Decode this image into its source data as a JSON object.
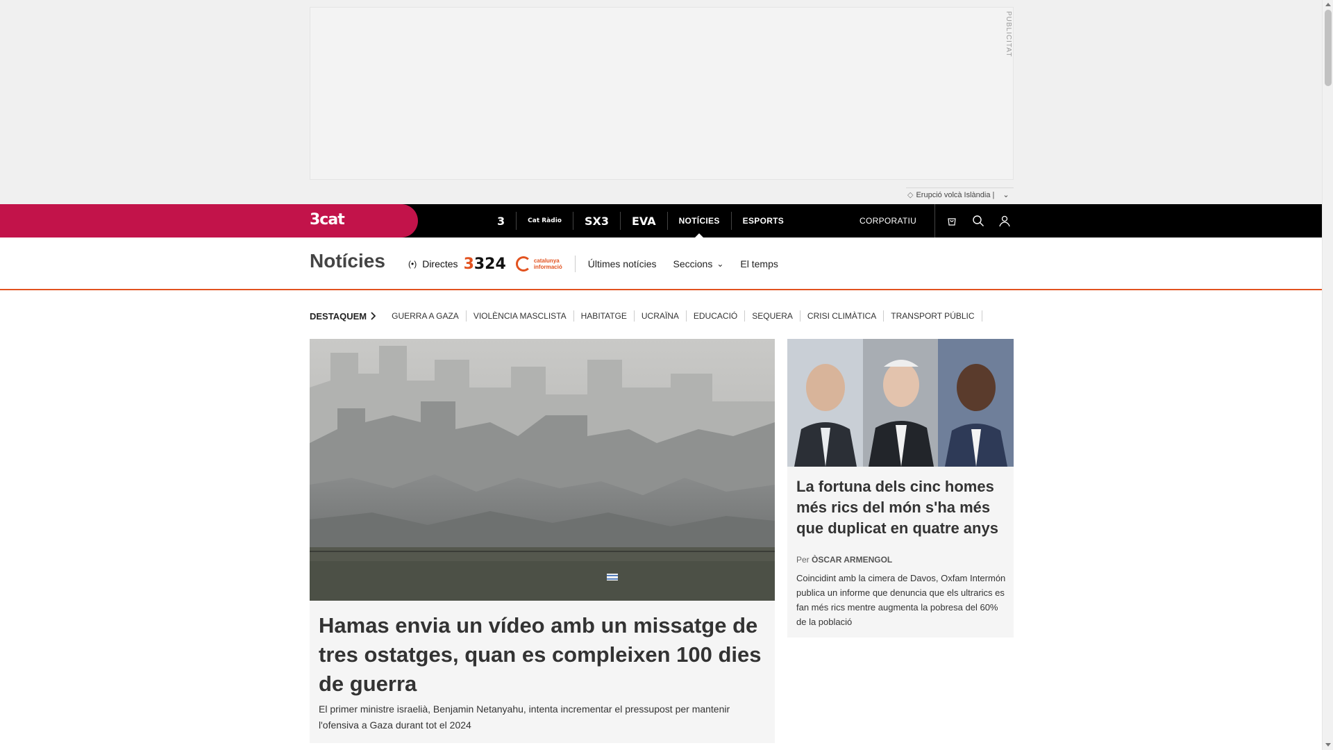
{
  "ad": {
    "label": "PUBLICITAT"
  },
  "trending": {
    "text": "Erupció volcà Islàndia |"
  },
  "topbar": {
    "logo": "3cat",
    "channels": [
      {
        "label": "3"
      },
      {
        "label": "Cat Ràdio"
      },
      {
        "label": "SX3"
      },
      {
        "label": "EVA"
      },
      {
        "label": "NOTÍCIES"
      },
      {
        "label": "ESPORTS"
      }
    ],
    "corporate": "CORPORATIU"
  },
  "section": {
    "title": "Notícies",
    "live": "Directes",
    "logo_324": "324",
    "catinfo_line1": "catalunya",
    "catinfo_line2": "informació",
    "nav": [
      {
        "label": "Últimes notícies"
      },
      {
        "label": "Seccions"
      },
      {
        "label": "El temps"
      }
    ]
  },
  "highlights": {
    "title": "DESTAQUEM",
    "items": [
      "GUERRA A GAZA",
      "VIOLÈNCIA MASCLISTA",
      "HABITATGE",
      "UCRAÏNA",
      "EDUCACIÓ",
      "SEQUERA",
      "CRISI CLIMÀTICA",
      "TRANSPORT PÚBLIC"
    ]
  },
  "main_story": {
    "title": "Hamas envia un vídeo amb un missatge de tres ostatges, quan es compleixen 100 dies de guerra",
    "lead": "El primer ministre israelià, Benjamin Netanyahu, intenta incrementar el pressupost per mantenir l'ofensiva a Gaza durant tot el 2024"
  },
  "side_story": {
    "title": "La fortuna dels cinc homes més rics del món s'ha més que duplicat en quatre anys",
    "author_prefix": "Per",
    "author": "ÒSCAR ARMENGOL",
    "lead": "Coincidint amb la cimera de Davos, Oxfam Intermón publica un informe que denuncia que els ultrarics es fan més rics mentre augmenta la pobresa del 60% de la població"
  },
  "colors": {
    "brand": "#c2134a",
    "accent": "#e2521f",
    "topbar": "#000000"
  },
  "icons": [
    "tag-icon",
    "chevron-down-icon",
    "shop-bag-icon",
    "search-icon",
    "user-icon",
    "live-broadcast-icon",
    "chevron-right-icon"
  ]
}
